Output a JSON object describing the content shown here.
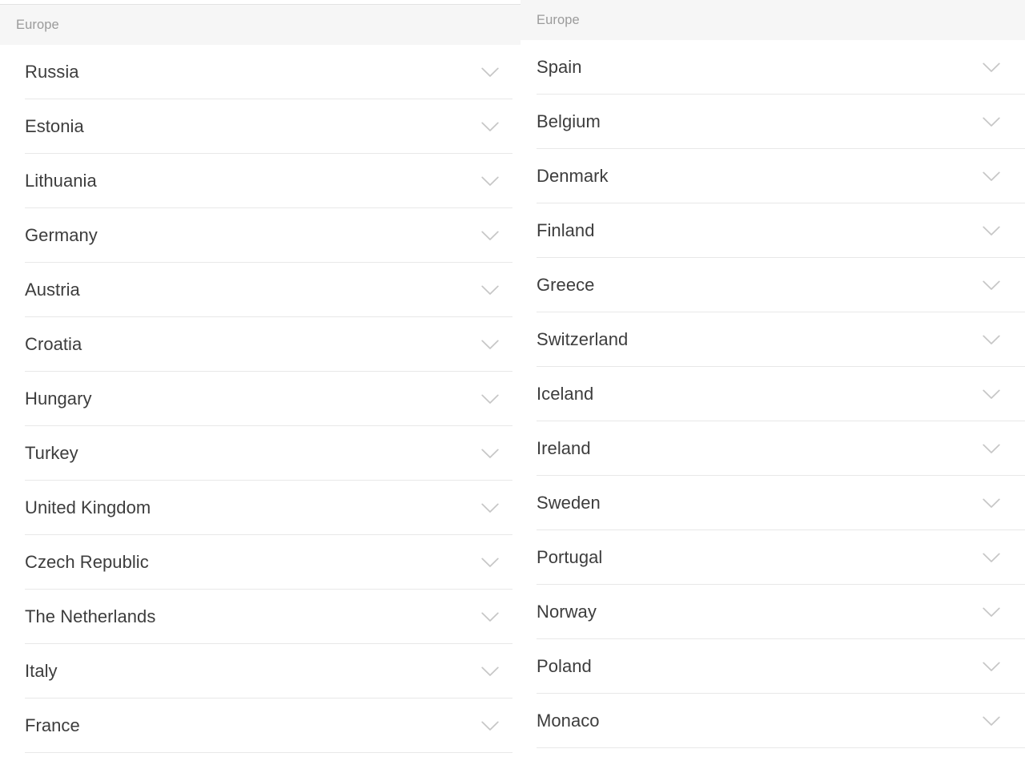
{
  "panels": [
    {
      "id": "left",
      "header": "Europe",
      "rows": [
        {
          "name": "Russia",
          "icon": "chevron-down-icon"
        },
        {
          "name": "Estonia",
          "icon": "chevron-down-icon"
        },
        {
          "name": "Lithuania",
          "icon": "chevron-down-icon"
        },
        {
          "name": "Germany",
          "icon": "chevron-down-icon"
        },
        {
          "name": "Austria",
          "icon": "chevron-down-icon"
        },
        {
          "name": "Croatia",
          "icon": "chevron-down-icon"
        },
        {
          "name": "Hungary",
          "icon": "chevron-down-icon"
        },
        {
          "name": "Turkey",
          "icon": "chevron-down-icon"
        },
        {
          "name": "United Kingdom",
          "icon": "chevron-down-icon"
        },
        {
          "name": "Czech Republic",
          "icon": "chevron-down-icon"
        },
        {
          "name": "The Netherlands",
          "icon": "chevron-down-icon"
        },
        {
          "name": "Italy",
          "icon": "chevron-down-icon"
        },
        {
          "name": "France",
          "icon": "chevron-down-icon"
        }
      ]
    },
    {
      "id": "right",
      "header": "Europe",
      "rows": [
        {
          "name": "Spain",
          "icon": "chevron-down-icon"
        },
        {
          "name": "Belgium",
          "icon": "chevron-down-icon"
        },
        {
          "name": "Denmark",
          "icon": "chevron-down-icon"
        },
        {
          "name": "Finland",
          "icon": "chevron-down-icon"
        },
        {
          "name": "Greece",
          "icon": "chevron-down-icon"
        },
        {
          "name": "Switzerland",
          "icon": "chevron-down-icon"
        },
        {
          "name": "Iceland",
          "icon": "chevron-down-icon"
        },
        {
          "name": "Ireland",
          "icon": "chevron-down-icon"
        },
        {
          "name": "Sweden",
          "icon": "chevron-down-icon"
        },
        {
          "name": "Portugal",
          "icon": "chevron-down-icon"
        },
        {
          "name": "Norway",
          "icon": "chevron-down-icon"
        },
        {
          "name": "Poland",
          "icon": "chevron-down-icon"
        },
        {
          "name": "Monaco",
          "icon": "chevron-down-icon"
        }
      ]
    }
  ],
  "colors": {
    "background": "#ffffff",
    "header_band": "#f6f6f6",
    "header_text": "#9b9b9b",
    "row_text": "#3d3d3d",
    "separator": "#e8e8e8",
    "chevron": "#c6c6c6"
  }
}
